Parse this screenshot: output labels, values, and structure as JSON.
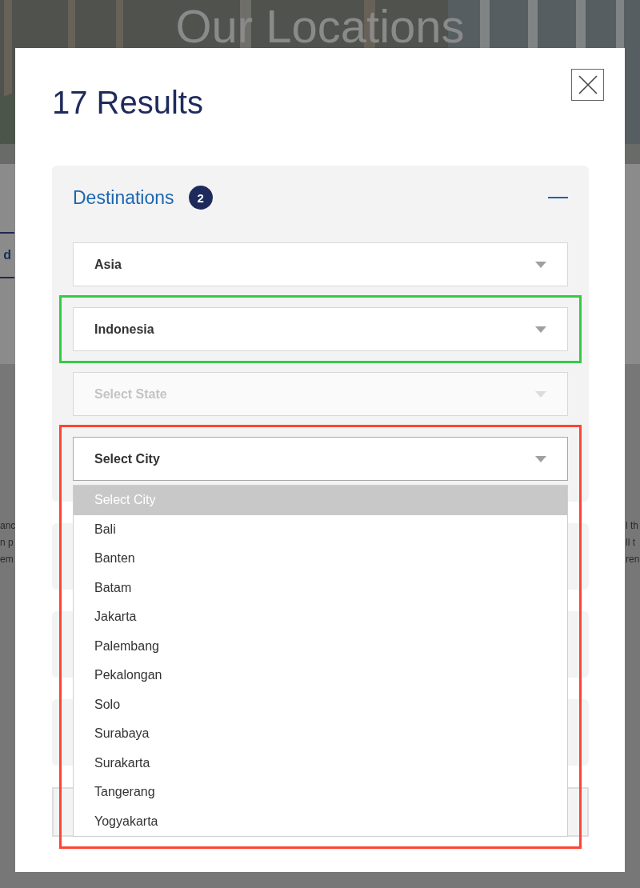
{
  "background": {
    "hero_title": "Our Locations",
    "tab_fragment": "d",
    "left_text": [
      "anc",
      "n p",
      "em"
    ],
    "right_text": [
      "l th",
      "ll t",
      "ren"
    ]
  },
  "modal": {
    "title": "17 Results",
    "filter": {
      "title": "Destinations",
      "count": "2",
      "expanded": true,
      "selects": [
        {
          "value": "Asia",
          "disabled": false,
          "open": false
        },
        {
          "value": "Indonesia",
          "disabled": false,
          "open": false,
          "color": "#33cc44"
        },
        {
          "value": "Select State",
          "disabled": true,
          "open": false
        },
        {
          "value": "Select City",
          "disabled": false,
          "open": true,
          "color": "#ff4433",
          "options": [
            {
              "label": "Select City",
              "selected": true
            },
            {
              "label": "Bali",
              "selected": false
            },
            {
              "label": "Banten",
              "selected": false
            },
            {
              "label": "Batam",
              "selected": false
            },
            {
              "label": "Jakarta",
              "selected": false
            },
            {
              "label": "Palembang",
              "selected": false
            },
            {
              "label": "Pekalongan",
              "selected": false
            },
            {
              "label": "Solo",
              "selected": false
            },
            {
              "label": "Surabaya",
              "selected": false
            },
            {
              "label": "Surakarta",
              "selected": false
            },
            {
              "label": "Tangerang",
              "selected": false
            },
            {
              "label": "Yogyakarta",
              "selected": false
            }
          ]
        }
      ]
    },
    "collapsed_panels": [
      {
        "kind": "panel"
      },
      {
        "kind": "panel"
      },
      {
        "kind": "panel"
      },
      {
        "kind": "bordered"
      }
    ]
  }
}
